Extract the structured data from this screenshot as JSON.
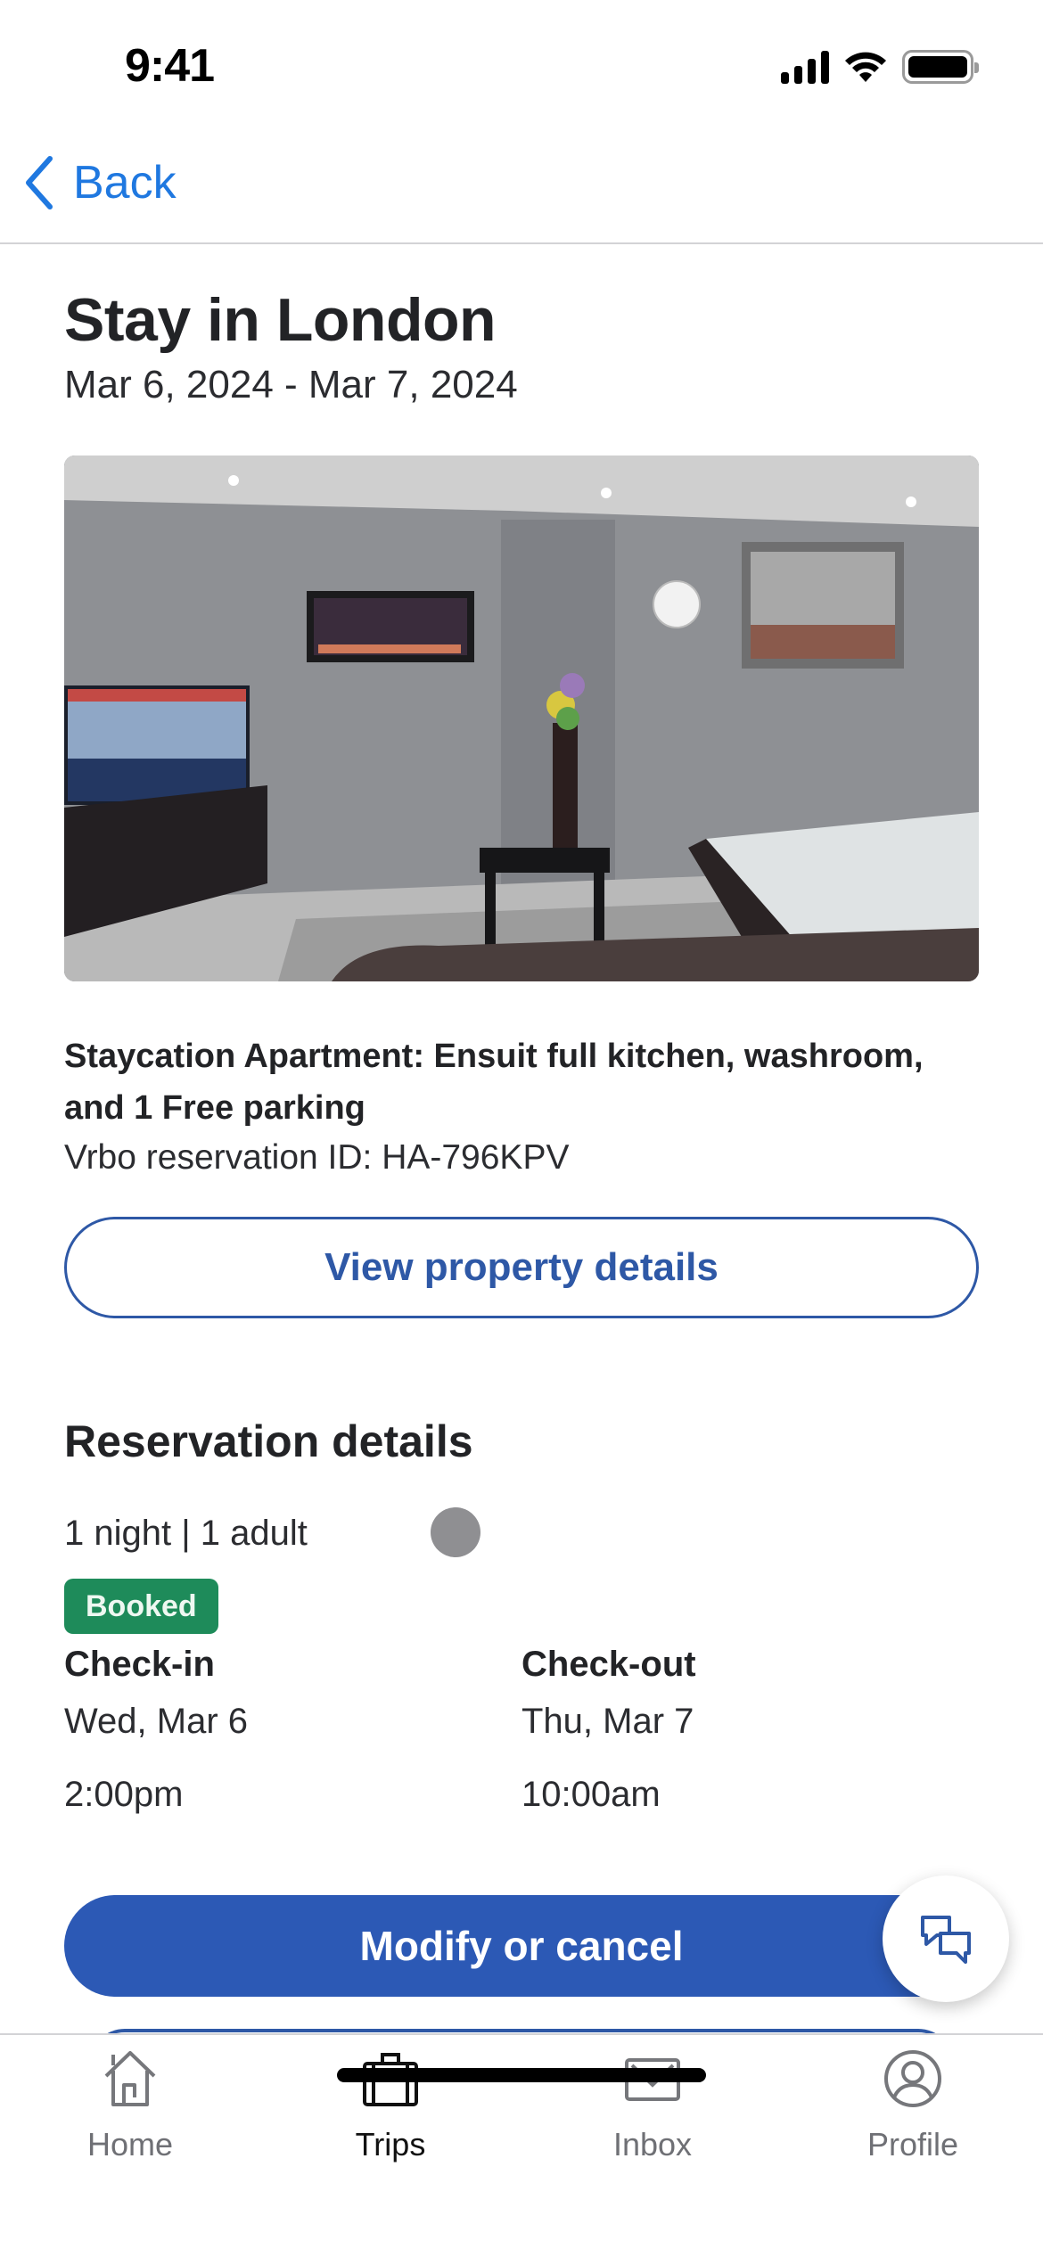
{
  "status_bar": {
    "time": "9:41",
    "icons": [
      "cellular-signal-icon",
      "wifi-icon",
      "battery-icon"
    ]
  },
  "nav": {
    "back_label": "Back",
    "back_icon": "chevron-left-icon"
  },
  "header": {
    "title": "Stay in London",
    "date_range": "Mar 6, 2024 - Mar 7, 2024"
  },
  "property": {
    "photo_alt": "Apartment living area with TV, wall fireplace, vase with flowers, clock, framed city print, coffee table and bed",
    "name": "Staycation Apartment:  Ensuit  full kitchen, washroom, and 1 Free  parking",
    "reservation_id": "Vrbo reservation ID: HA-796KPV",
    "view_details_label": "View property details"
  },
  "reservation": {
    "section_title": "Reservation details",
    "summary": "1 night | 1 adult",
    "status": "Booked",
    "status_color": "#1e8b5a",
    "check_in": {
      "label": "Check-in",
      "date": "Wed, Mar 6",
      "time": "2:00pm"
    },
    "check_out": {
      "label": "Check-out",
      "date": "Thu, Mar 7",
      "time": "10:00am"
    }
  },
  "actions": {
    "modify_label": "Modify or cancel",
    "chat_icon": "chat-bubbles-icon",
    "primary_color": "#2c59b5"
  },
  "tab_bar": {
    "active": "Trips",
    "items": [
      {
        "label": "Home",
        "icon": "home-icon"
      },
      {
        "label": "Trips",
        "icon": "suitcase-icon"
      },
      {
        "label": "Inbox",
        "icon": "envelope-icon"
      },
      {
        "label": "Profile",
        "icon": "profile-icon"
      }
    ]
  }
}
